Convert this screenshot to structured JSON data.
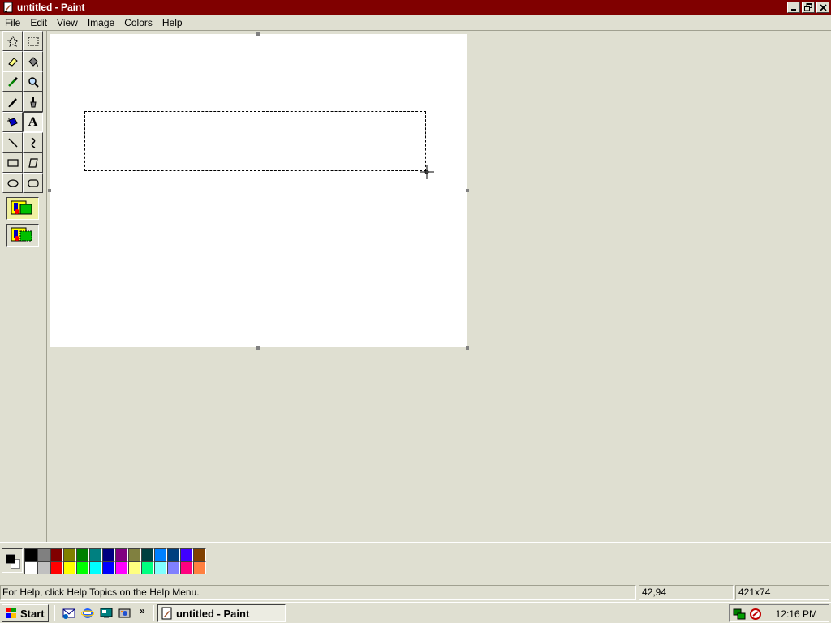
{
  "window": {
    "title": "untitled - Paint",
    "icon": "paint-app-icon",
    "controls": [
      "minimize-icon",
      "restore-icon",
      "close-icon"
    ]
  },
  "menu": [
    "File",
    "Edit",
    "View",
    "Image",
    "Colors",
    "Help"
  ],
  "tools": [
    {
      "name": "free-form-select",
      "icon": "free-form-select-icon"
    },
    {
      "name": "select",
      "icon": "rectangle-select-icon"
    },
    {
      "name": "eraser",
      "icon": "eraser-icon"
    },
    {
      "name": "fill",
      "icon": "fill-bucket-icon"
    },
    {
      "name": "pick-color",
      "icon": "eyedropper-icon"
    },
    {
      "name": "magnifier",
      "icon": "magnifier-icon"
    },
    {
      "name": "pencil",
      "icon": "pencil-icon"
    },
    {
      "name": "brush",
      "icon": "brush-icon"
    },
    {
      "name": "airbrush",
      "icon": "airbrush-icon"
    },
    {
      "name": "text",
      "icon": "text-icon",
      "label": "A",
      "selected": true
    },
    {
      "name": "line",
      "icon": "line-icon"
    },
    {
      "name": "curve",
      "icon": "curve-icon"
    },
    {
      "name": "rectangle",
      "icon": "rectangle-icon"
    },
    {
      "name": "polygon",
      "icon": "polygon-icon"
    },
    {
      "name": "ellipse",
      "icon": "ellipse-icon"
    },
    {
      "name": "rounded-rectangle",
      "icon": "rounded-rectangle-icon"
    }
  ],
  "tool_options": [
    "opaque-background-icon",
    "transparent-background-icon"
  ],
  "palette": {
    "foreground": "#000000",
    "background": "#ffffff",
    "colors": [
      "#000000",
      "#808080",
      "#800000",
      "#808000",
      "#008000",
      "#008080",
      "#000080",
      "#800080",
      "#808040",
      "#004040",
      "#0080ff",
      "#004080",
      "#4000ff",
      "#804000",
      "#ffffff",
      "#c0c0c0",
      "#ff0000",
      "#ffff00",
      "#00ff00",
      "#00ffff",
      "#0000ff",
      "#ff00ff",
      "#ffff80",
      "#00ff80",
      "#80ffff",
      "#8080ff",
      "#ff0080",
      "#ff8040"
    ]
  },
  "status": {
    "help": "For Help, click Help Topics on the Help Menu.",
    "position": "42,94",
    "size": "421x74"
  },
  "taskbar": {
    "start_label": "Start",
    "quick_launch": [
      "outlook-express-icon",
      "internet-explorer-icon",
      "desktop-icon",
      "channels-icon"
    ],
    "more": "»",
    "task_label": "untitled - Paint",
    "tray_icons": [
      "network-icon",
      "volume-icon"
    ],
    "clock": "12:16 PM"
  }
}
